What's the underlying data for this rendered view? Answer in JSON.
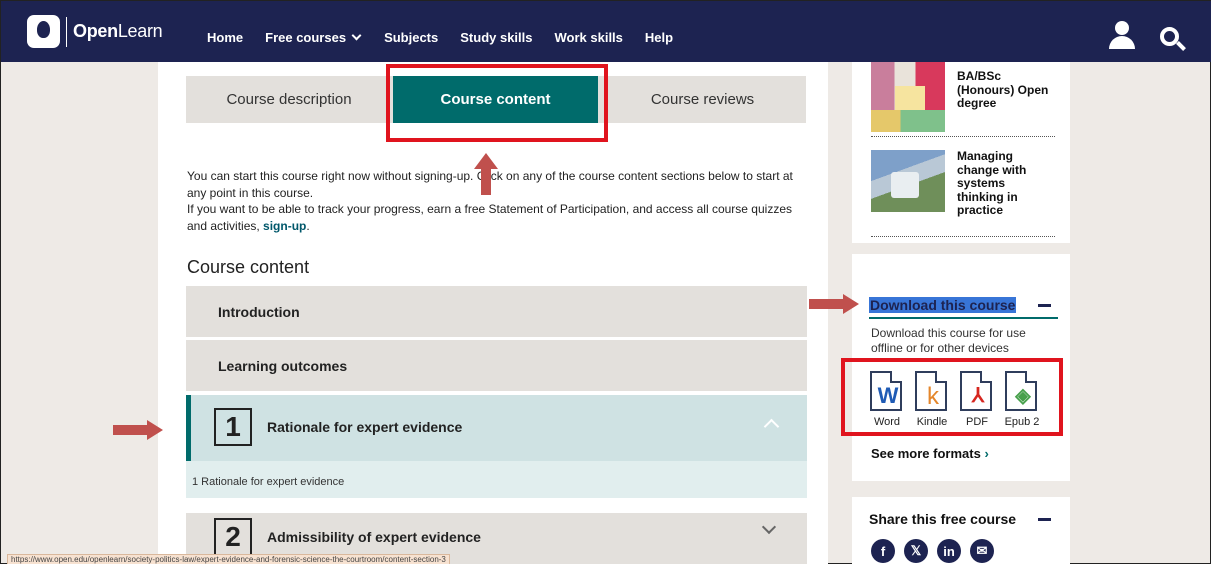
{
  "brand": {
    "name_bold": "Open",
    "name_light": "Learn"
  },
  "nav": {
    "items": [
      "Home",
      "Free courses",
      "Subjects",
      "Study skills",
      "Work skills",
      "Help"
    ]
  },
  "tabs": [
    "Course description",
    "Course content",
    "Course reviews"
  ],
  "active_tab": "Course content",
  "intro": {
    "line1": "You can start this course right now without signing-up. Click on any of the course content sections below to start at any point in this course.",
    "line2_prefix": "If you want to be able to track your progress, earn a free Statement of Participation, and access all course quizzes and activities, ",
    "signup_link": "sign-up",
    "line2_suffix": "."
  },
  "course_content": {
    "heading": "Course content",
    "sections": [
      {
        "title": "Introduction"
      },
      {
        "title": "Learning outcomes"
      },
      {
        "number": "1",
        "title": "Rationale for expert evidence",
        "expanded": true,
        "subitem": "1 Rationale for expert evidence"
      },
      {
        "number": "2",
        "title": "Admissibility of expert evidence",
        "expanded": false
      }
    ]
  },
  "sidebar": {
    "related_courses": [
      {
        "title": "BA/BSc (Honours) Open degree"
      },
      {
        "title": "Managing change with systems thinking in practice"
      }
    ],
    "download": {
      "heading": "Download this course",
      "description": "Download this course for use offline or for other devices",
      "formats": [
        {
          "label": "Word",
          "icon": "word-doc-icon",
          "glyph": "W"
        },
        {
          "label": "Kindle",
          "icon": "kindle-doc-icon",
          "glyph": "k"
        },
        {
          "label": "PDF",
          "icon": "pdf-doc-icon",
          "glyph": "⅄"
        },
        {
          "label": "Epub 2",
          "icon": "epub-doc-icon",
          "glyph": "◈"
        }
      ],
      "see_more": "See more formats",
      "see_more_chevron": "›"
    },
    "share": {
      "heading": "Share this free course",
      "icons": [
        {
          "name": "facebook-icon",
          "glyph": "f"
        },
        {
          "name": "x-icon",
          "glyph": "𝕏"
        },
        {
          "name": "linkedin-icon",
          "glyph": "in"
        },
        {
          "name": "email-icon",
          "glyph": "✉"
        }
      ]
    }
  },
  "status_url": "https://www.open.edu/openlearn/society-politics-law/expert-evidence-and-forensic-science-the-courtroom/content-section-3",
  "colors": {
    "nav_bg": "#1d2351",
    "accent_teal": "#006b6b",
    "annotation_red": "#e0141e",
    "arrow_red": "#c0504d"
  }
}
